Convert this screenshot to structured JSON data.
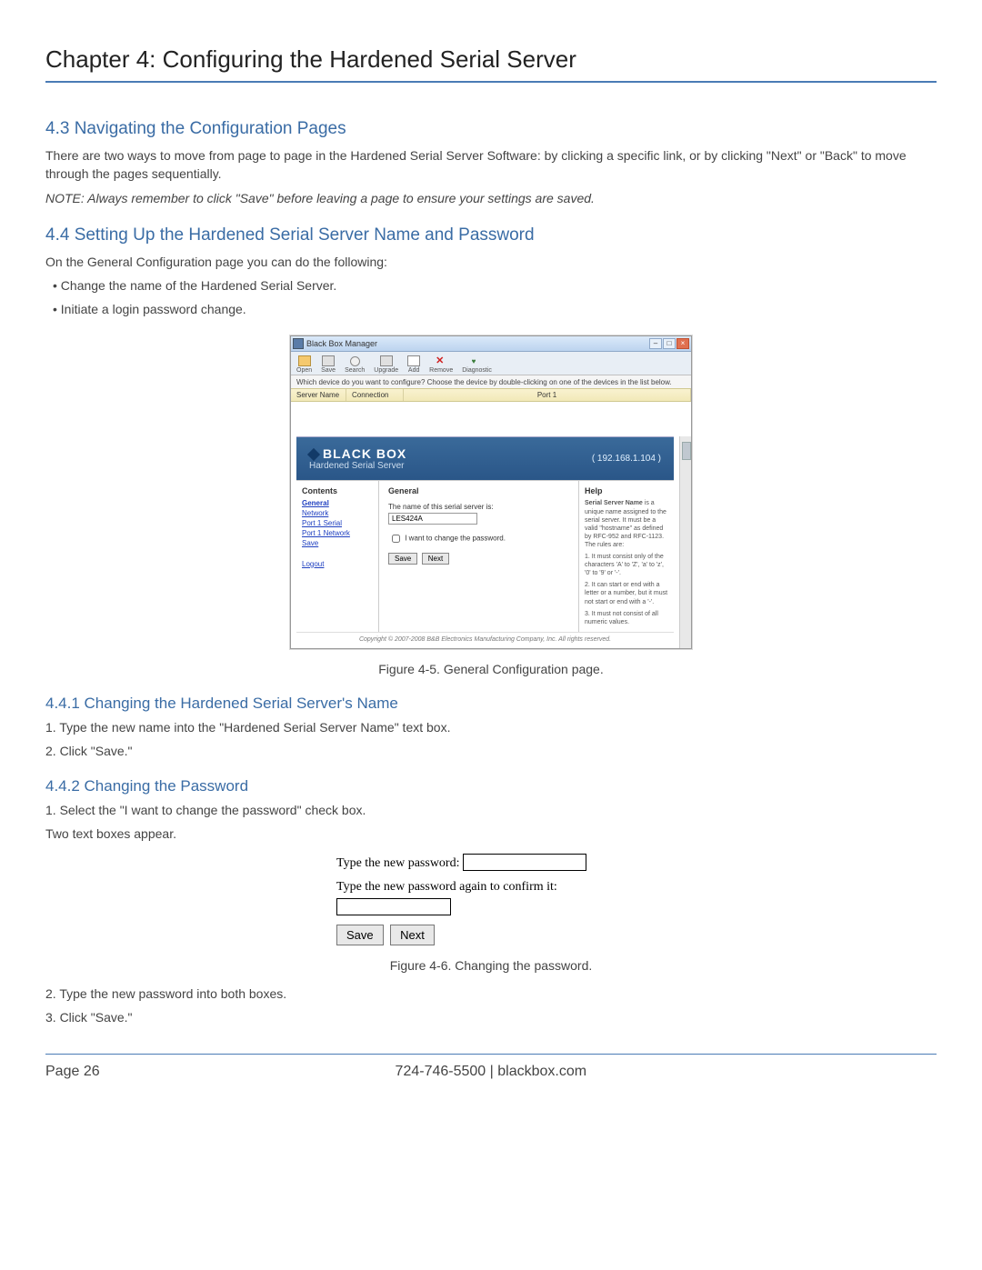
{
  "chapter_title": "Chapter 4: Configuring the Hardened Serial Server",
  "s43": {
    "heading": "4.3 Navigating the Configuration Pages",
    "p1": "There are two ways to move from page to page in the Hardened Serial Server Software: by clicking a specific link, or by clicking \"Next\" or \"Back\" to move through the pages sequentially.",
    "note": "NOTE: Always remember to click \"Save\" before leaving a page to ensure your settings are saved."
  },
  "s44": {
    "heading": "4.4 Setting Up the Hardened Serial Server Name and Password",
    "p1": "On the General Configuration page you can do the following:",
    "b1": "• Change the name of the Hardened Serial Server.",
    "b2": "• Initiate a login password change."
  },
  "fig5": {
    "caption": "Figure 4-5. General Configuration page.",
    "title": "Black Box Manager",
    "toolbar": {
      "open": "Open",
      "save": "Save",
      "search": "Search",
      "upgrade": "Upgrade",
      "add": "Add",
      "remove": "Remove",
      "diag": "Diagnostic"
    },
    "instruction": "Which device do you want to configure? Choose the device by double-clicking on one of the devices in the list below.",
    "cols": {
      "server_name": "Server Name",
      "connection": "Connection",
      "port1": "Port 1"
    },
    "brand": "BLACK BOX",
    "subbrand": "Hardened Serial Server",
    "ip": "( 192.168.1.104 )",
    "side": {
      "contents": "Contents",
      "general": "General",
      "network": "Network",
      "p1serial": "Port 1 Serial",
      "p1net": "Port 1 Network",
      "save": "Save",
      "logout": "Logout"
    },
    "main": {
      "heading": "General",
      "name_label": "The name of this serial server is:",
      "name_value": "LES424A",
      "cb_label": "I want to change the password.",
      "save": "Save",
      "next": "Next"
    },
    "help": {
      "heading": "Help",
      "t1": "Serial Server Name",
      "p1": " is a unique name assigned to the serial server. It must be a valid \"hostname\" as defined by RFC-952 and RFC-1123. The rules are:",
      "r1": "1. It must consist only of the characters 'A' to 'Z', 'a' to 'z', '0' to '9' or '-'.",
      "r2": "2. It can start or end with a letter or a number, but it must not start or end with a '-'.",
      "r3": "3. It must not consist of all numeric values."
    },
    "copyright": "Copyright © 2007-2008 B&B Electronics Manufacturing Company, Inc. All rights reserved."
  },
  "s441": {
    "heading": "4.4.1 Changing the Hardened Serial Server's Name",
    "l1": "1. Type the new name into the \"Hardened Serial Server Name\" text box.",
    "l2": "2. Click \"Save.\""
  },
  "s442": {
    "heading": "4.4.2 Changing the Password",
    "l1": "1. Select the \"I want to change the password\" check box.",
    "l2": "Two text boxes appear.",
    "fig6_caption": "Figure 4-6. Changing the password.",
    "fig6": {
      "pw1_label": "Type the new password:",
      "pw2_label": "Type the new password again to confirm it:",
      "save": "Save",
      "next": "Next"
    },
    "l3": "2. Type the new password into both boxes.",
    "l4": "3. Click \"Save.\""
  },
  "footer": {
    "page": "Page 26",
    "contact": "724-746-5500   |   blackbox.com"
  }
}
